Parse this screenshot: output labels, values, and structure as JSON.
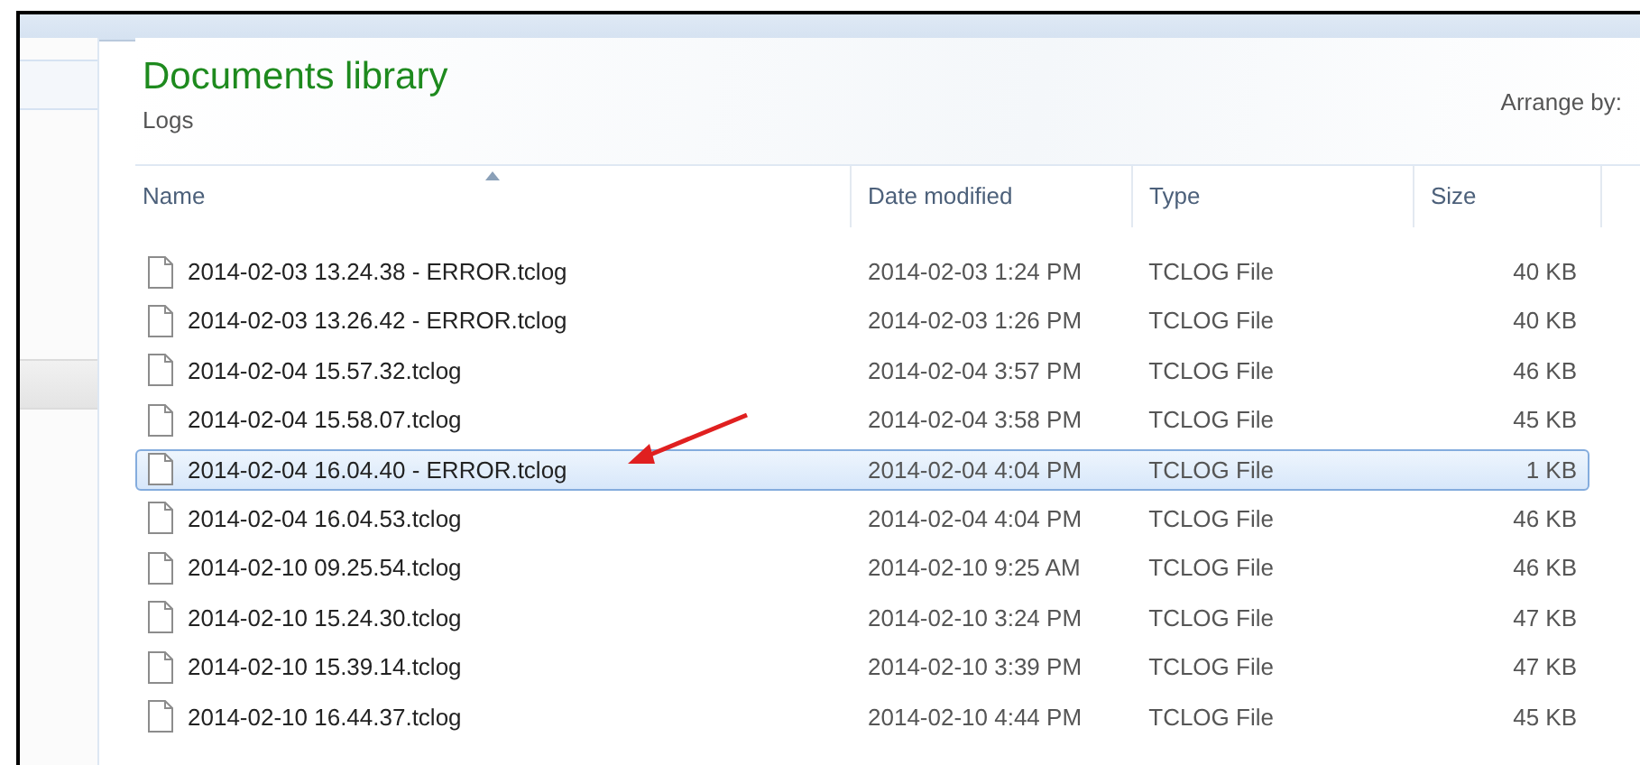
{
  "header": {
    "title": "Documents library",
    "subtitle": "Logs",
    "arrange_label": "Arrange by:"
  },
  "table": {
    "columns": [
      {
        "label": "Name",
        "sorted": true
      },
      {
        "label": "Date modified",
        "sorted": false
      },
      {
        "label": "Type",
        "sorted": false
      },
      {
        "label": "Size",
        "sorted": false
      }
    ],
    "rows": [
      {
        "name": "2014-02-03 13.24.38 - ERROR.tclog",
        "date": "2014-02-03 1:24 PM",
        "type": "TCLOG File",
        "size": "40 KB",
        "selected": false
      },
      {
        "name": "2014-02-03 13.26.42 - ERROR.tclog",
        "date": "2014-02-03 1:26 PM",
        "type": "TCLOG File",
        "size": "40 KB",
        "selected": false
      },
      {
        "name": "2014-02-04 15.57.32.tclog",
        "date": "2014-02-04 3:57 PM",
        "type": "TCLOG File",
        "size": "46 KB",
        "selected": false
      },
      {
        "name": "2014-02-04 15.58.07.tclog",
        "date": "2014-02-04 3:58 PM",
        "type": "TCLOG File",
        "size": "45 KB",
        "selected": false
      },
      {
        "name": "2014-02-04 16.04.40 - ERROR.tclog",
        "date": "2014-02-04 4:04 PM",
        "type": "TCLOG File",
        "size": "1 KB",
        "selected": true
      },
      {
        "name": "2014-02-04 16.04.53.tclog",
        "date": "2014-02-04 4:04 PM",
        "type": "TCLOG File",
        "size": "46 KB",
        "selected": false
      },
      {
        "name": "2014-02-10 09.25.54.tclog",
        "date": "2014-02-10 9:25 AM",
        "type": "TCLOG File",
        "size": "46 KB",
        "selected": false
      },
      {
        "name": "2014-02-10 15.24.30.tclog",
        "date": "2014-02-10 3:24 PM",
        "type": "TCLOG File",
        "size": "47 KB",
        "selected": false
      },
      {
        "name": "2014-02-10 15.39.14.tclog",
        "date": "2014-02-10 3:39 PM",
        "type": "TCLOG File",
        "size": "47 KB",
        "selected": false
      },
      {
        "name": "2014-02-10 16.44.37.tclog",
        "date": "2014-02-10 4:44 PM",
        "type": "TCLOG File",
        "size": "45 KB",
        "selected": false
      }
    ]
  }
}
